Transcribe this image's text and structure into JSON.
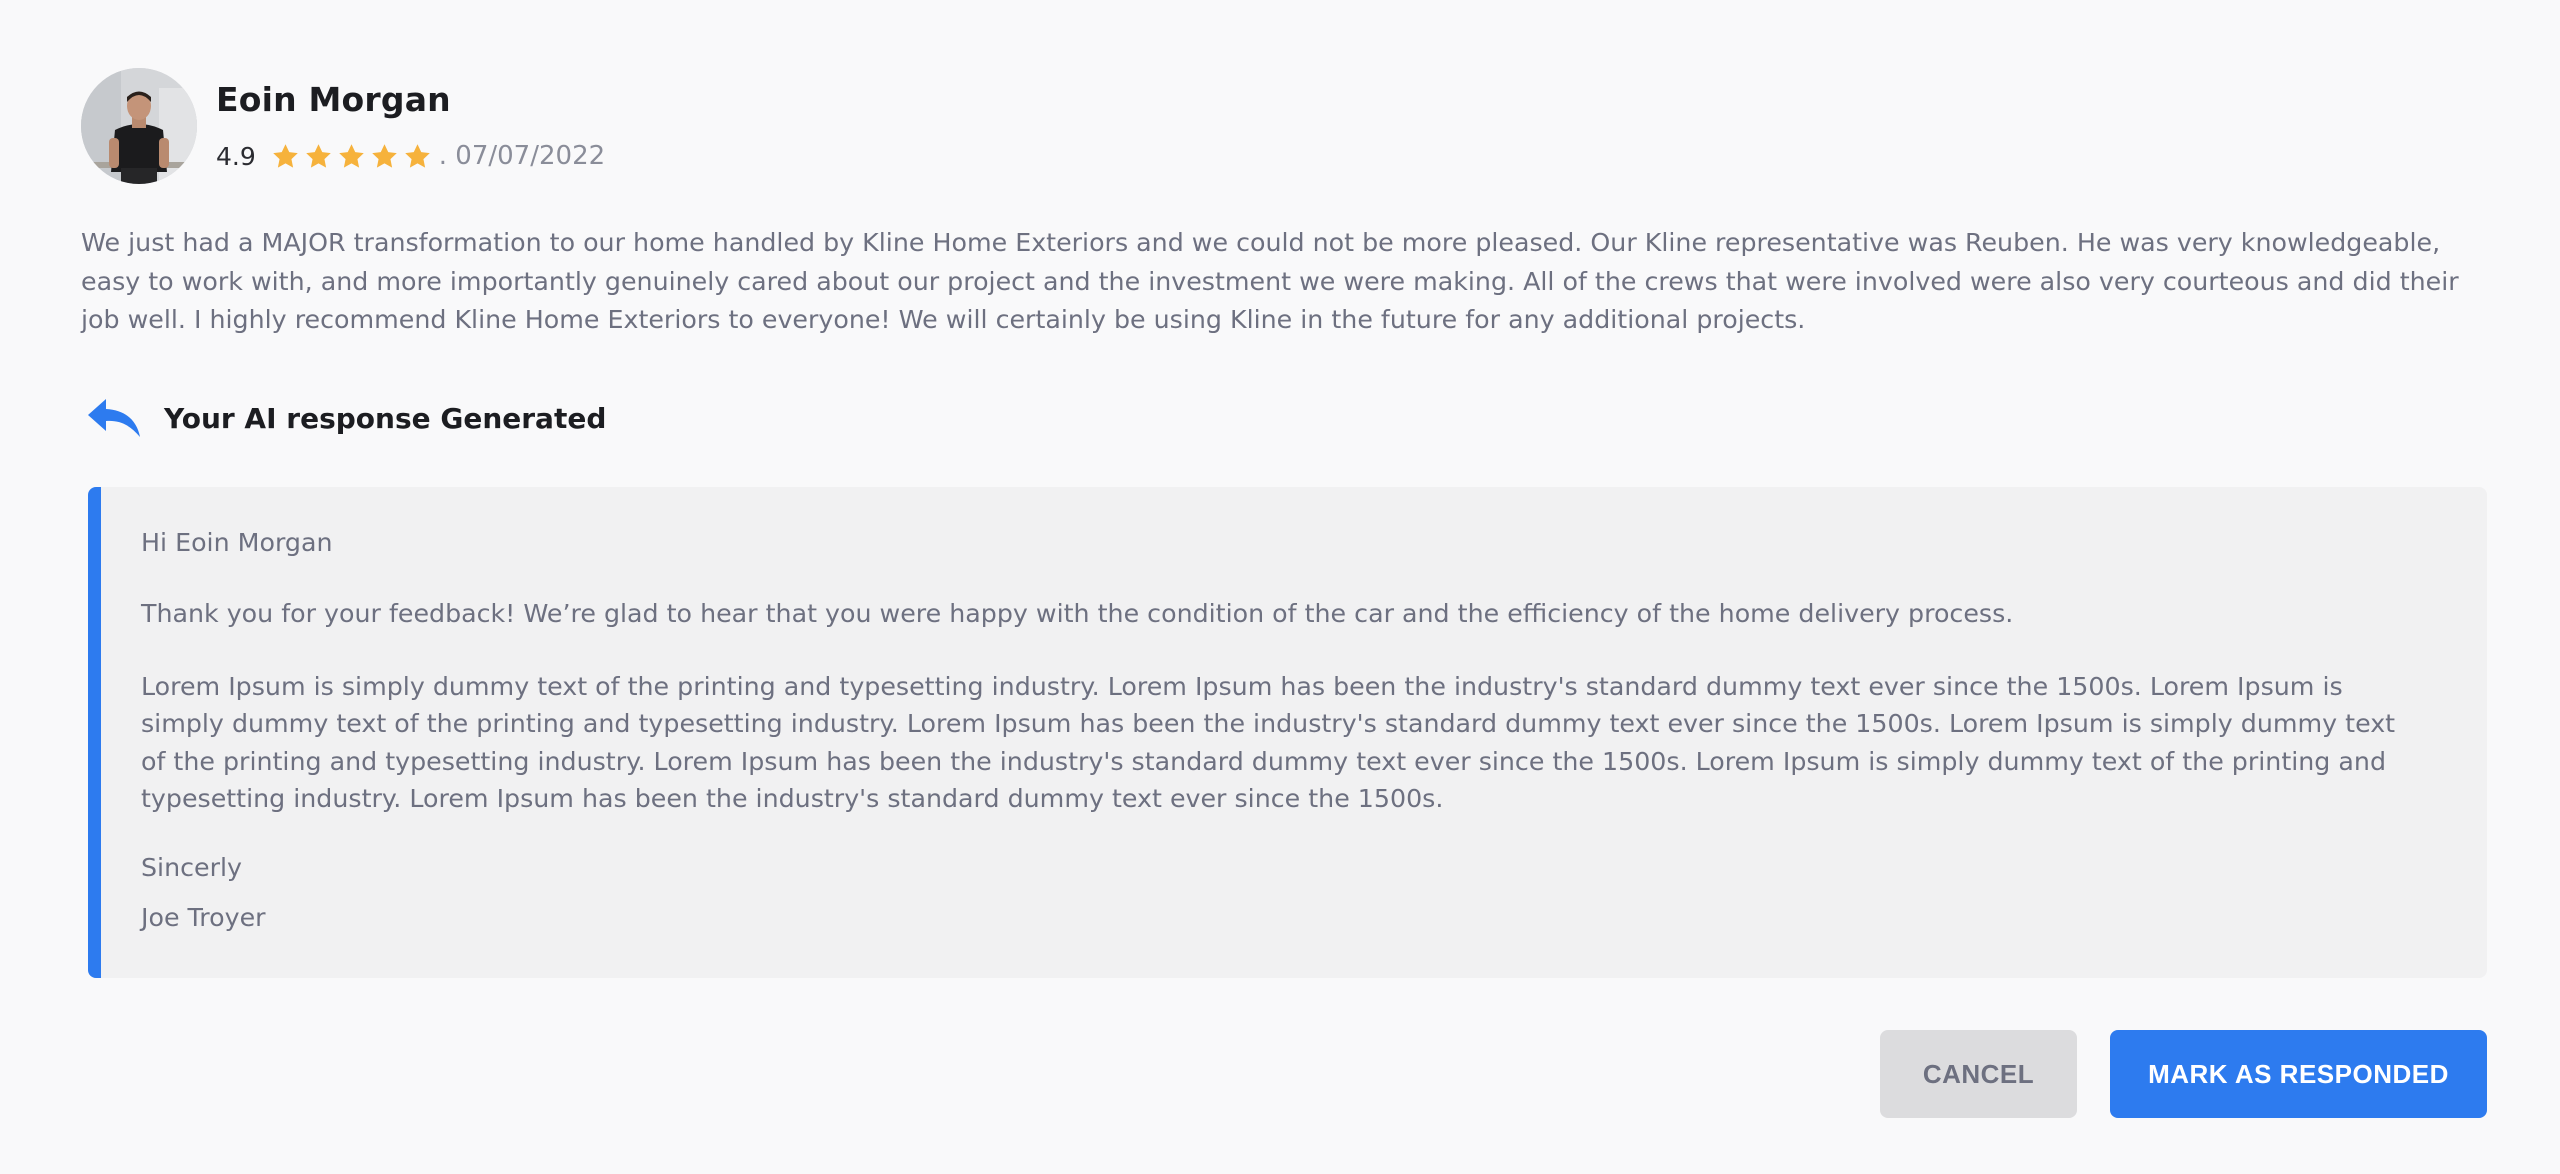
{
  "reviewer": {
    "name": "Eoin Morgan",
    "rating": "4.9",
    "stars": 5,
    "date": ". 07/07/2022",
    "avatar_icon": "avatar-photo"
  },
  "review": {
    "text": "We just had a MAJOR transformation to our home handled by Kline Home Exteriors and we could not be more pleased. Our Kline representative was Reuben. He was very knowledgeable, easy to work with, and more importantly genuinely cared about our project and the investment we were making. All of the crews that were involved were also very courteous and did their job well. I highly recommend Kline Home Exteriors to everyone! We will certainly be using Kline in the future for any additional projects."
  },
  "ai_response": {
    "title": "Your AI response Generated",
    "icon": "reply-icon",
    "greeting": "Hi Eoin Morgan",
    "thanks": "Thank you for your feedback! We’re glad to hear that you were happy with the condition of the car and the efficiency of the home delivery process.",
    "body": "Lorem Ipsum is simply dummy text of the printing and typesetting industry. Lorem Ipsum has been the industry's standard dummy text ever since the 1500s. Lorem Ipsum is simply dummy text of the printing and typesetting industry. Lorem Ipsum has been the industry's standard dummy text ever since the 1500s. Lorem Ipsum is simply dummy text of the printing and typesetting industry. Lorem Ipsum has been the industry's standard dummy text ever since the 1500s. Lorem Ipsum is simply dummy text of the printing and typesetting industry. Lorem Ipsum has been the industry's standard dummy text ever since the 1500s.",
    "closing": "Sincerly",
    "signature": "Joe Troyer"
  },
  "actions": {
    "cancel_label": "CANCEL",
    "primary_label": "MARK AS RESPONDED"
  },
  "colors": {
    "accent": "#2d7bef",
    "star": "#f6b23c",
    "muted_text": "#6d7080",
    "panel_bg": "#f1f1f2"
  }
}
